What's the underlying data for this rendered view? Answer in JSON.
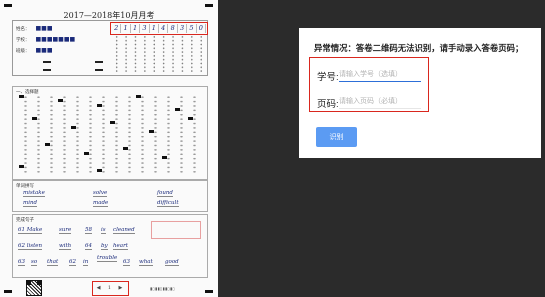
{
  "sheet": {
    "title": "2017—2018年10月月考",
    "labels": {
      "name": "姓名：",
      "school": "学校：",
      "class": "班级：",
      "mc_section": "一、选择题",
      "word_section": "单词拼写",
      "fill_section": "完成句子"
    },
    "student_id_digits": [
      "2",
      "1",
      "1",
      "3",
      "1",
      "4",
      "8",
      "3",
      "5",
      "0"
    ],
    "words": [
      "mistake",
      "solve",
      "found",
      "mind",
      "made",
      "difficult"
    ],
    "sentences": [
      [
        "61 Make",
        "sure",
        "58",
        "is",
        "cleaned"
      ],
      [
        "62 listen",
        "with",
        "64",
        "by",
        "heart"
      ],
      [
        "63",
        "so",
        "that",
        "62",
        "in",
        "trouble",
        "63",
        "what",
        "good"
      ]
    ],
    "pager": [
      "◀",
      "1",
      "▶"
    ]
  },
  "panel": {
    "warning": "异常情况：答卷二维码无法识别，请手动录入答卷页码；",
    "student_id": {
      "label": "学号:",
      "placeholder": "请输入学号（选填）",
      "value": ""
    },
    "page_code": {
      "label": "页码:",
      "placeholder": "请输入页码（必填）",
      "value": ""
    },
    "recognize_button": "识别"
  },
  "colors": {
    "highlight": "#d9271e",
    "accent": "#5b9bf3",
    "input_focus": "#2d6fd8"
  }
}
